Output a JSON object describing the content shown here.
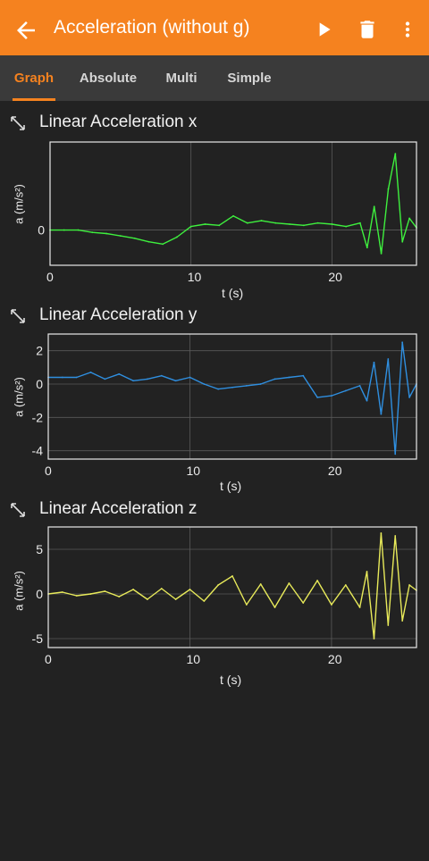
{
  "appbar": {
    "title": "Acceleration (without g)",
    "icons": [
      "back-arrow-icon",
      "play-icon",
      "trash-icon",
      "more-vert-icon"
    ],
    "color": "#f5821f"
  },
  "tabs": [
    {
      "label": "Graph",
      "active": true
    },
    {
      "label": "Absolute",
      "active": false
    },
    {
      "label": "Multi",
      "active": false
    },
    {
      "label": "Simple",
      "active": false
    }
  ],
  "chart_data": [
    {
      "type": "line",
      "title": "Linear Acceleration x",
      "xlabel": "t (s)",
      "ylabel": "a (m/s²)",
      "xlim": [
        0,
        26
      ],
      "ylim": [
        -3,
        7.5
      ],
      "xticks": [
        0,
        10,
        20
      ],
      "yticks": [
        0
      ],
      "grid": true,
      "series": [
        {
          "color": "#3ef03e",
          "x": [
            0,
            1,
            2,
            3,
            4,
            5,
            6,
            7,
            8,
            9,
            10,
            11,
            12,
            13,
            14,
            15,
            16,
            17,
            18,
            19,
            20,
            21,
            22,
            22.5,
            23,
            23.5,
            24,
            24.5,
            25,
            25.5,
            26
          ],
          "y": [
            0,
            0,
            0,
            -0.2,
            -0.3,
            -0.5,
            -0.7,
            -1.0,
            -1.2,
            -0.6,
            0.3,
            0.5,
            0.4,
            1.2,
            0.6,
            0.8,
            0.6,
            0.5,
            0.4,
            0.6,
            0.5,
            0.3,
            0.6,
            -1.5,
            2.0,
            -2.0,
            3.5,
            6.5,
            -1.0,
            1.0,
            0.2
          ]
        }
      ]
    },
    {
      "type": "line",
      "title": "Linear Acceleration y",
      "xlabel": "t (s)",
      "ylabel": "a (m/s²)",
      "xlim": [
        0,
        26
      ],
      "ylim": [
        -4.5,
        3
      ],
      "xticks": [
        0,
        10,
        20
      ],
      "yticks": [
        2,
        0,
        -2,
        -4
      ],
      "grid": true,
      "series": [
        {
          "color": "#2f8fe0",
          "x": [
            0,
            1,
            2,
            3,
            4,
            5,
            6,
            7,
            8,
            9,
            10,
            11,
            12,
            13,
            14,
            15,
            16,
            17,
            18,
            19,
            20,
            21,
            22,
            22.5,
            23,
            23.5,
            24,
            24.5,
            25,
            25.5,
            26
          ],
          "y": [
            0.4,
            0.4,
            0.4,
            0.7,
            0.3,
            0.6,
            0.2,
            0.3,
            0.5,
            0.2,
            0.4,
            0.0,
            -0.3,
            -0.2,
            -0.1,
            0.0,
            0.3,
            0.4,
            0.5,
            -0.8,
            -0.7,
            -0.4,
            -0.1,
            -1.0,
            1.3,
            -1.8,
            1.5,
            -4.2,
            2.5,
            -0.8,
            0.0
          ]
        }
      ]
    },
    {
      "type": "line",
      "title": "Linear Acceleration z",
      "xlabel": "t (s)",
      "ylabel": "a (m/s²)",
      "xlim": [
        0,
        26
      ],
      "ylim": [
        -6,
        7.5
      ],
      "xticks": [
        0,
        10,
        20
      ],
      "yticks": [
        5,
        0,
        -5
      ],
      "grid": true,
      "series": [
        {
          "color": "#e8ea5a",
          "x": [
            0,
            1,
            2,
            3,
            4,
            5,
            6,
            7,
            8,
            9,
            10,
            11,
            12,
            13,
            14,
            15,
            16,
            17,
            18,
            19,
            20,
            21,
            22,
            22.5,
            23,
            23.5,
            24,
            24.5,
            25,
            25.5,
            26
          ],
          "y": [
            0,
            0.2,
            -0.2,
            0,
            0.3,
            -0.3,
            0.5,
            -0.6,
            0.6,
            -0.6,
            0.5,
            -0.8,
            1.0,
            2.0,
            -1.2,
            1.1,
            -1.5,
            1.2,
            -1.0,
            1.5,
            -1.2,
            1.0,
            -1.5,
            2.5,
            -5.0,
            6.8,
            -3.5,
            6.5,
            -3.0,
            1.0,
            0.4
          ]
        }
      ]
    }
  ]
}
